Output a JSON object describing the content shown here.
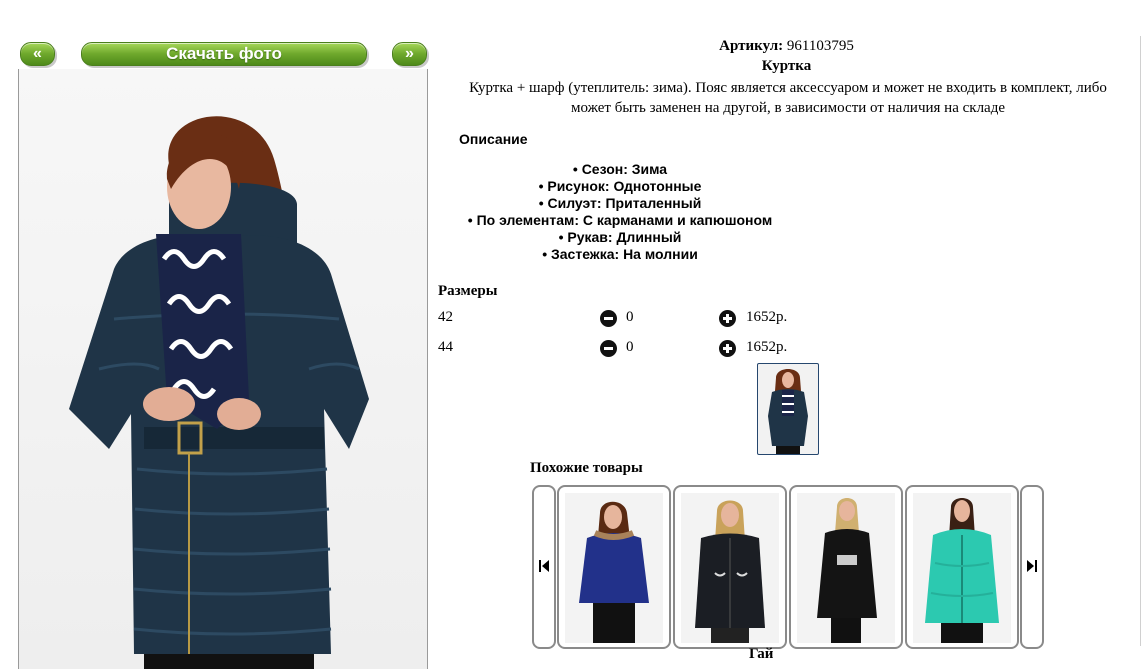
{
  "gallery": {
    "prev_label": "«",
    "next_label": "»",
    "download_label": "Скачать фото"
  },
  "product": {
    "sku_label": "Артикул:",
    "sku_value": "961103795",
    "title": "Куртка",
    "description": "Куртка + шарф (утеплитель: зима). Пояс является аксессуаром и может не входить в комплект, либо может быть заменен на другой, в зависимости от наличия на складе"
  },
  "description_section": {
    "heading": "Описание",
    "attributes": [
      "Сезон: Зима",
      "Рисунок: Однотонные",
      "Силуэт: Приталенный",
      "По элементам: С карманами и капюшоном",
      "Рукав: Длинный",
      "Застежка: На молнии"
    ]
  },
  "sizes": {
    "heading": "Размеры",
    "rows": [
      {
        "size": "42",
        "qty": "0",
        "price": "1652р."
      },
      {
        "size": "44",
        "qty": "0",
        "price": "1652р."
      }
    ]
  },
  "similar": {
    "heading": "Похожие товары",
    "cut_text": "Гай"
  },
  "colors": {
    "button_green": "#6ea82c",
    "jacket_navy": "#1f3447",
    "thumb_border": "#26476e"
  },
  "icons": {
    "minus": "minus-circle-icon",
    "plus": "plus-circle-icon",
    "carousel_prev": "skip-previous-icon",
    "carousel_next": "skip-next-icon"
  }
}
